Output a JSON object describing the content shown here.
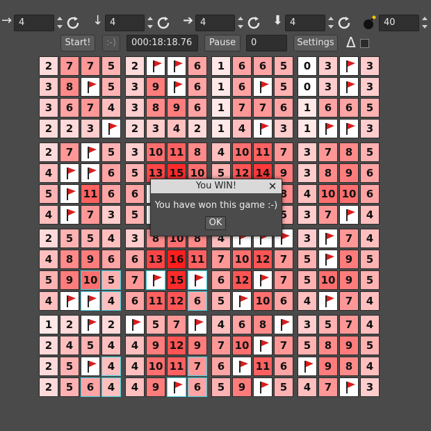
{
  "toolbar": {
    "size_fields": [
      {
        "arrow_icon": "arrow-right-thin-icon",
        "glyph": "→",
        "value": "4"
      },
      {
        "arrow_icon": "arrow-down-thin-icon",
        "glyph": "↓",
        "value": "4"
      },
      {
        "arrow_icon": "arrow-right-bold-icon",
        "glyph": "➔",
        "value": "4"
      },
      {
        "arrow_icon": "arrow-down-bold-icon",
        "glyph": "⬇",
        "value": "4"
      }
    ],
    "mines_value": "40",
    "start_label": "Start!",
    "smiley_label": ":-)",
    "timer": "000:18:18.76",
    "pause_label": "Pause",
    "flag_count": "0",
    "settings_label": "Settings",
    "delta_label": "Δ"
  },
  "board": {
    "blocks": 4,
    "block_size": 4,
    "rows": [
      [
        "2",
        "7",
        "7",
        "5",
        "2",
        "F",
        "F",
        "6",
        "1",
        "6",
        "6",
        "5",
        "0",
        "3",
        "F",
        "3"
      ],
      [
        "3",
        "8",
        "F",
        "5",
        "3",
        "9",
        "F",
        "6",
        "1",
        "6",
        "F",
        "5",
        "0",
        "3",
        "F",
        "3"
      ],
      [
        "3",
        "6",
        "7",
        "4",
        "3",
        "8",
        "9",
        "6",
        "1",
        "7",
        "7",
        "6",
        "1",
        "6",
        "6",
        "5"
      ],
      [
        "2",
        "2",
        "3",
        "F",
        "2",
        "3",
        "4",
        "2",
        "1",
        "4",
        "F",
        "3",
        "1",
        "F",
        "F",
        "3"
      ],
      [
        "2",
        "7",
        "F",
        "5",
        "3",
        "10",
        "11",
        "8",
        "4",
        "10",
        "11",
        "7",
        "3",
        "7",
        "8",
        "5"
      ],
      [
        "4",
        "F",
        "F",
        "6",
        "5",
        "13",
        "15",
        "10",
        "5",
        "12",
        "14",
        "9",
        "3",
        "8",
        "9",
        "6"
      ],
      [
        "5",
        "F",
        "11",
        "6",
        "6",
        "",
        "",
        "",
        "",
        "",
        "",
        "8",
        "4",
        "10",
        "10",
        "6"
      ],
      [
        "4",
        "F",
        "7",
        "3",
        "5",
        "",
        "",
        "",
        "",
        "",
        "",
        "5",
        "3",
        "7",
        "F",
        "4"
      ],
      [
        "2",
        "5",
        "5",
        "4",
        "3",
        "8",
        "10",
        "8",
        "4",
        "F",
        "F",
        "F",
        "3",
        "F",
        "7",
        "4"
      ],
      [
        "4",
        "8",
        "9",
        "6",
        "6",
        "13",
        "16",
        "11",
        "7",
        "10",
        "12",
        "7",
        "5",
        "F",
        "9",
        "5"
      ],
      [
        "5",
        "9",
        "10",
        "5",
        "7",
        "F",
        "15",
        "F",
        "6",
        "12",
        "F",
        "7",
        "5",
        "10",
        "9",
        "5"
      ],
      [
        "4",
        "F",
        "F",
        "4",
        "6",
        "11",
        "12",
        "6",
        "5",
        "F",
        "10",
        "6",
        "4",
        "F",
        "7",
        "4"
      ],
      [
        "1",
        "2",
        "F",
        "2",
        "F",
        "5",
        "7",
        "F",
        "4",
        "6",
        "8",
        "F",
        "3",
        "5",
        "7",
        "4"
      ],
      [
        "2",
        "4",
        "5",
        "4",
        "4",
        "9",
        "12",
        "9",
        "7",
        "10",
        "F",
        "7",
        "5",
        "8",
        "9",
        "5"
      ],
      [
        "2",
        "5",
        "F",
        "4",
        "4",
        "10",
        "11",
        "7",
        "6",
        "F",
        "11",
        "6",
        "F",
        "9",
        "8",
        "4"
      ],
      [
        "2",
        "5",
        "6",
        "4",
        "4",
        "9",
        "F",
        "6",
        "5",
        "9",
        "F",
        "5",
        "4",
        "7",
        "F",
        "3"
      ]
    ],
    "highlighted_cells": [
      [
        10,
        2
      ],
      [
        10,
        3
      ],
      [
        11,
        2
      ],
      [
        11,
        3
      ],
      [
        14,
        3
      ],
      [
        15,
        2
      ],
      [
        15,
        3
      ],
      [
        10,
        5
      ],
      [
        10,
        7
      ],
      [
        11,
        7
      ],
      [
        14,
        7
      ],
      [
        15,
        6
      ],
      [
        15,
        7
      ]
    ]
  },
  "colors": {
    "flag_red": "#d81d1d",
    "cell_white": "#ffffff",
    "highlight_cyan": "#3fd0e0"
  },
  "dialog": {
    "title": "You WIN!",
    "message": "You have won this game :-)",
    "ok_label": "OK"
  }
}
